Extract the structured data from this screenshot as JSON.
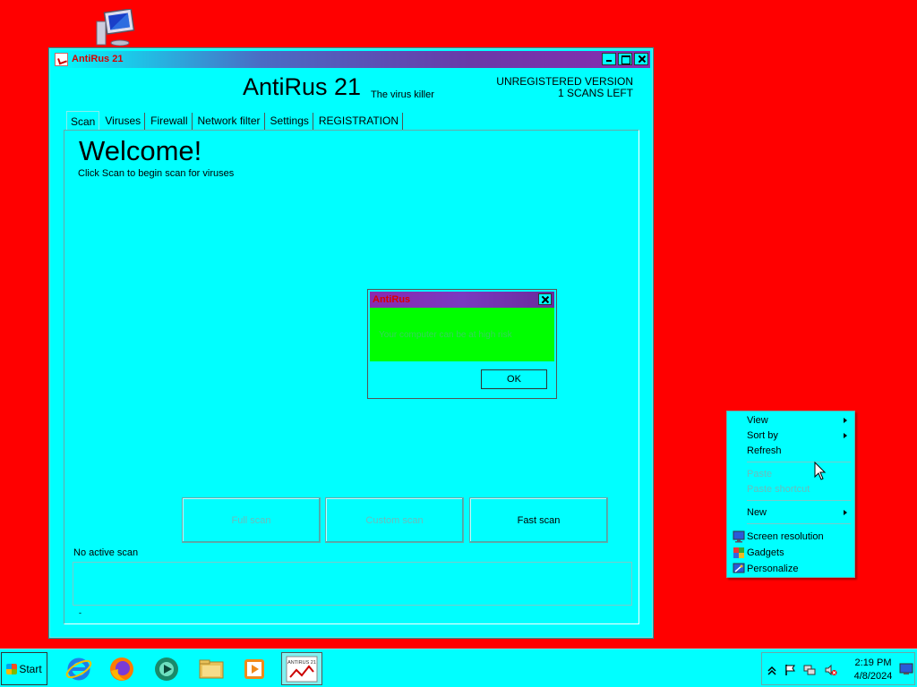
{
  "desktop": {
    "background_color": "#ff0000",
    "icons": [
      {
        "name": "computer-icon"
      }
    ]
  },
  "main_window": {
    "title": "AntiRus 21",
    "app_name": "AntiRus 21",
    "tagline": "The virus killer",
    "registration_status": [
      "UNREGISTERED VERSION",
      "1 SCANS LEFT"
    ],
    "tabs": [
      {
        "label": "Scan",
        "active": true
      },
      {
        "label": "Viruses"
      },
      {
        "label": "Firewall"
      },
      {
        "label": "Network filter"
      },
      {
        "label": "Settings"
      },
      {
        "label": "REGISTRATION"
      }
    ],
    "welcome_heading": "Welcome!",
    "welcome_sub": "Click Scan to begin scan for viruses",
    "scan_buttons": [
      {
        "label": "Full scan",
        "enabled": false
      },
      {
        "label": "Custom scan",
        "enabled": false
      },
      {
        "label": "Fast scan",
        "enabled": true
      }
    ],
    "scan_status": "No active scan",
    "panel_footer": "-"
  },
  "dialog": {
    "title": "AntiRus",
    "message": "Your computer can be at high risk",
    "ok_label": "OK"
  },
  "context_menu": {
    "items": [
      {
        "label": "View",
        "submenu": true
      },
      {
        "label": "Sort by",
        "submenu": true
      },
      {
        "label": "Refresh"
      },
      {
        "label": "Paste",
        "disabled": true
      },
      {
        "label": "Paste shortcut",
        "disabled": true
      },
      {
        "label": "New",
        "submenu": true
      },
      {
        "label": "Screen resolution",
        "icon": "screen-resolution-icon"
      },
      {
        "label": "Gadgets",
        "icon": "gadgets-icon"
      },
      {
        "label": "Personalize",
        "icon": "personalize-icon"
      }
    ]
  },
  "taskbar": {
    "start_label": "Start",
    "pinned": [
      {
        "icon": "internet-explorer-icon"
      },
      {
        "icon": "firefox-icon"
      },
      {
        "icon": "media-center-icon"
      },
      {
        "icon": "file-explorer-icon"
      },
      {
        "icon": "media-player-icon"
      },
      {
        "icon": "antirus-icon",
        "label": "ANTIRUS 21",
        "active": true
      }
    ],
    "tray": {
      "icons": [
        "show-hidden-icon",
        "action-center-flag-icon",
        "network-icon",
        "volume-muted-icon"
      ],
      "time": "2:19 PM",
      "date": "4/8/2024"
    }
  }
}
